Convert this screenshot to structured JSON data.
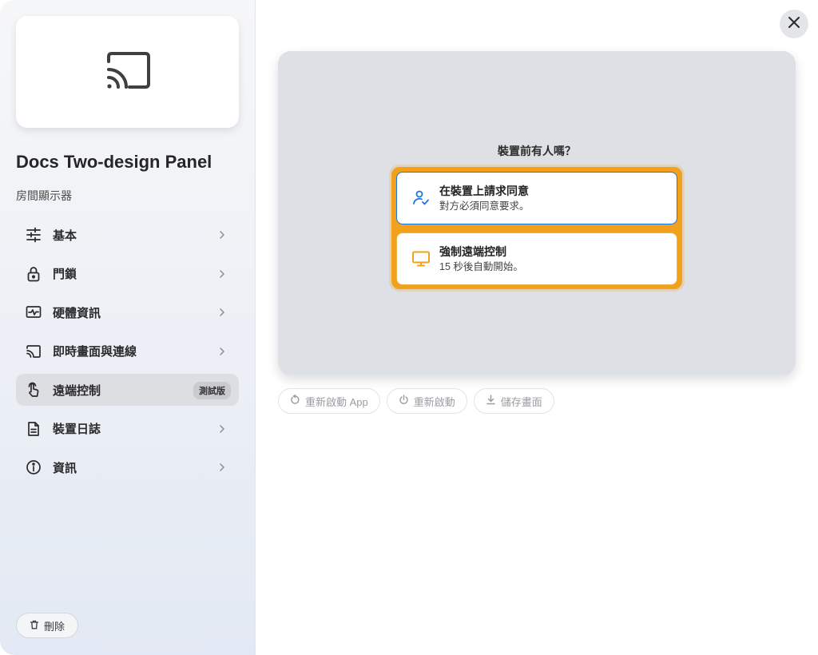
{
  "device": {
    "name": "Docs Two-design Panel",
    "type": "房間顯示器",
    "icon": "cast-icon"
  },
  "sidebar": {
    "items": [
      {
        "label": "基本",
        "icon": "sliders-icon"
      },
      {
        "label": "門鎖",
        "icon": "lock-icon"
      },
      {
        "label": "硬體資訊",
        "icon": "hardware-monitor-icon"
      },
      {
        "label": "即時畫面與連線",
        "icon": "cast-icon"
      },
      {
        "label": "遠端控制",
        "icon": "touch-hand-icon",
        "active": true,
        "badge": "測試版"
      },
      {
        "label": "裝置日誌",
        "icon": "document-icon"
      },
      {
        "label": "資訊",
        "icon": "info-icon"
      }
    ],
    "delete_label": "刪除"
  },
  "remote": {
    "question": "裝置前有人嗎？",
    "options": [
      {
        "title": "在裝置上請求同意",
        "subtitle": "對方必須同意要求。",
        "icon": "user-check-icon"
      },
      {
        "title": "強制遠端控制",
        "subtitle": "15 秒後自動開始。",
        "icon": "monitor-icon"
      }
    ]
  },
  "actions": [
    {
      "label": "重新啟動 App",
      "icon": "restart-icon"
    },
    {
      "label": "重新啟動",
      "icon": "power-icon"
    },
    {
      "label": "儲存畫面",
      "icon": "download-icon"
    }
  ],
  "colors": {
    "accent_blue": "#1b74e8",
    "accent_orange": "#f2a11d",
    "active_item_bg": "#dcdee2"
  }
}
